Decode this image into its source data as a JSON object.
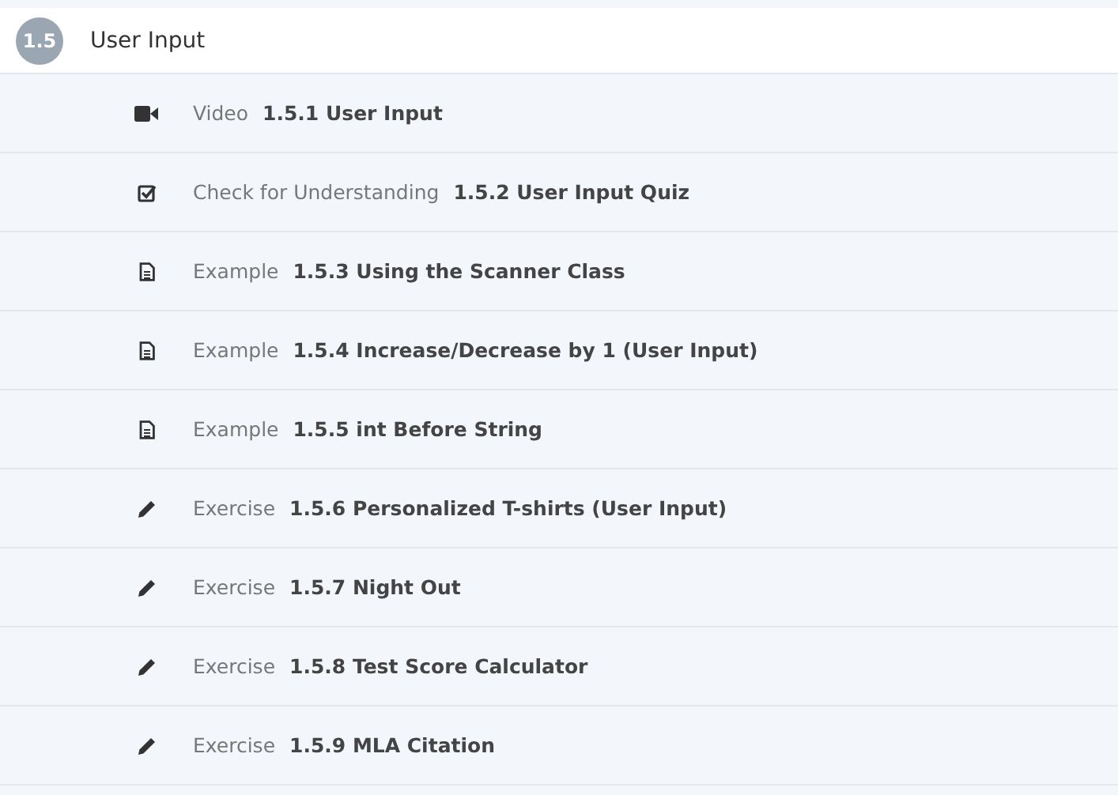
{
  "section": {
    "number": "1.5",
    "title": "User Input"
  },
  "items": [
    {
      "kind": "video",
      "type": "Video",
      "title": "1.5.1 User Input"
    },
    {
      "kind": "quiz",
      "type": "Check for Understanding",
      "title": "1.5.2 User Input Quiz"
    },
    {
      "kind": "example",
      "type": "Example",
      "title": "1.5.3 Using the Scanner Class"
    },
    {
      "kind": "example",
      "type": "Example",
      "title": "1.5.4 Increase/Decrease by 1 (User Input)"
    },
    {
      "kind": "example",
      "type": "Example",
      "title": "1.5.5 int Before String"
    },
    {
      "kind": "exercise",
      "type": "Exercise",
      "title": "1.5.6 Personalized T-shirts (User Input)"
    },
    {
      "kind": "exercise",
      "type": "Exercise",
      "title": "1.5.7 Night Out"
    },
    {
      "kind": "exercise",
      "type": "Exercise",
      "title": "1.5.8 Test Score Calculator"
    },
    {
      "kind": "exercise",
      "type": "Exercise",
      "title": "1.5.9 MLA Citation"
    }
  ]
}
